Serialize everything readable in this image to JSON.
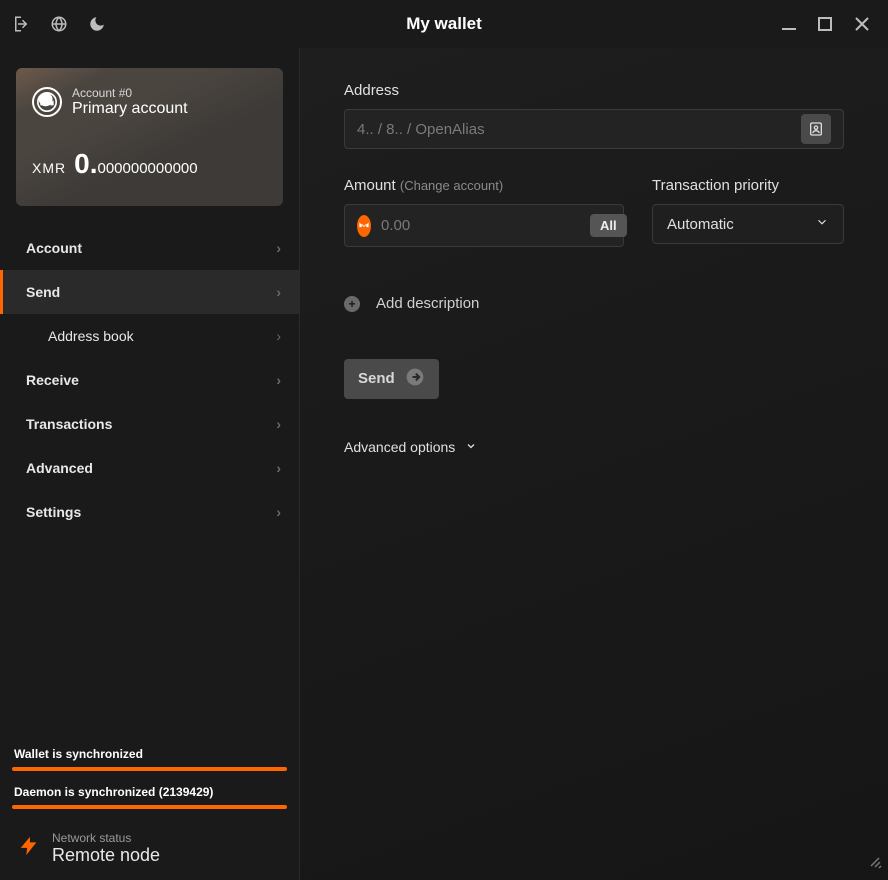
{
  "titlebar": {
    "title": "My wallet"
  },
  "account_card": {
    "account_label": "Account #0",
    "account_name": "Primary account",
    "currency": "XMR",
    "balance_major": "0.",
    "balance_minor": "000000000000"
  },
  "nav": {
    "account": "Account",
    "send": "Send",
    "address_book": "Address book",
    "receive": "Receive",
    "transactions": "Transactions",
    "advanced": "Advanced",
    "settings": "Settings"
  },
  "status": {
    "wallet_sync": "Wallet is synchronized",
    "daemon_sync": "Daemon is synchronized (2139429)",
    "network_status_label": "Network status",
    "network_status_value": "Remote node"
  },
  "form": {
    "address_label": "Address",
    "address_placeholder": "4.. / 8.. / OpenAlias",
    "amount_label": "Amount",
    "amount_hint": "(Change account)",
    "amount_placeholder": "0.00",
    "all_label": "All",
    "priority_label": "Transaction priority",
    "priority_value": "Automatic",
    "add_description": "Add description",
    "send_button": "Send",
    "advanced_options": "Advanced options"
  }
}
